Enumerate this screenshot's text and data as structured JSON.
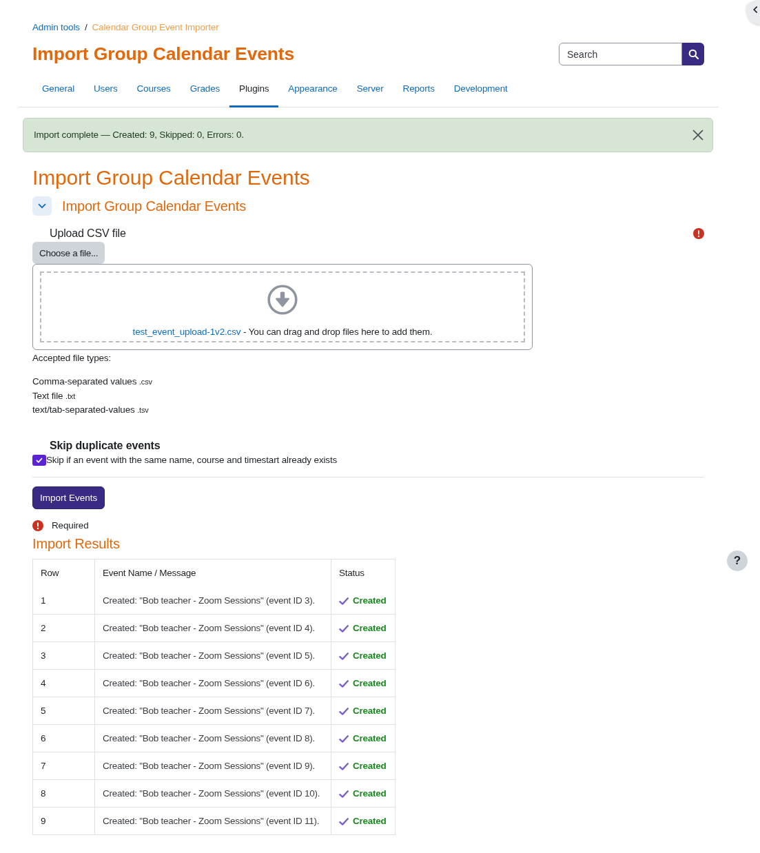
{
  "breadcrumb": {
    "separator": "/",
    "items": [
      {
        "label": "Admin tools",
        "kind": "link"
      },
      {
        "label": "Calendar Group Event Importer",
        "kind": "current"
      }
    ]
  },
  "page_title": "Import Group Calendar Events",
  "search": {
    "placeholder": "Search"
  },
  "tabs": [
    {
      "label": "General",
      "selected": false
    },
    {
      "label": "Users",
      "selected": false
    },
    {
      "label": "Courses",
      "selected": false
    },
    {
      "label": "Grades",
      "selected": false
    },
    {
      "label": "Plugins",
      "selected": true
    },
    {
      "label": "Appearance",
      "selected": false
    },
    {
      "label": "Server",
      "selected": false
    },
    {
      "label": "Reports",
      "selected": false
    },
    {
      "label": "Development",
      "selected": false
    }
  ],
  "alert": {
    "message": "Import complete — Created: 9, Skipped: 0, Errors: 0.",
    "dismissible": true
  },
  "heading": "Import Group Calendar Events",
  "section": {
    "title": "Import Group Calendar Events",
    "expanded": true
  },
  "upload": {
    "label": "Upload CSV file",
    "required": true,
    "button": "Choose a file...",
    "file_name": "test_event_upload-1v2.csv",
    "drop_hint": "- You can drag and drop files here to add them.",
    "accepted_label": "Accepted file types:",
    "file_types": [
      {
        "name": "Comma-separated values",
        "extension": ".csv"
      },
      {
        "name": "Text file",
        "extension": ".txt"
      },
      {
        "name": "text/tab-separated-values",
        "extension": ".tsv"
      }
    ]
  },
  "skip_duplicates": {
    "title": "Skip duplicate events",
    "label": "Skip if an event with the same name, course and timestart already exists",
    "checked": true
  },
  "submit_button": "Import Events",
  "required_note": "Required",
  "results": {
    "title": "Import Results",
    "columns": [
      "Row",
      "Event Name / Message",
      "Status"
    ],
    "rows": [
      {
        "row": "1",
        "message": "Created: \"Bob teacher - Zoom Sessions\" (event ID 3).",
        "status": "Created",
        "kind": "created"
      },
      {
        "row": "2",
        "message": "Created: \"Bob teacher - Zoom Sessions\" (event ID 4).",
        "status": "Created",
        "kind": "created"
      },
      {
        "row": "3",
        "message": "Created: \"Bob teacher - Zoom Sessions\" (event ID 5).",
        "status": "Created",
        "kind": "created"
      },
      {
        "row": "4",
        "message": "Created: \"Bob teacher - Zoom Sessions\" (event ID 6).",
        "status": "Created",
        "kind": "created"
      },
      {
        "row": "5",
        "message": "Created: \"Bob teacher - Zoom Sessions\" (event ID 7).",
        "status": "Created",
        "kind": "created"
      },
      {
        "row": "6",
        "message": "Created: \"Bob teacher - Zoom Sessions\" (event ID 8).",
        "status": "Created",
        "kind": "created"
      },
      {
        "row": "7",
        "message": "Created: \"Bob teacher - Zoom Sessions\" (event ID 9).",
        "status": "Created",
        "kind": "created"
      },
      {
        "row": "8",
        "message": "Created: \"Bob teacher - Zoom Sessions\" (event ID 10).",
        "status": "Created",
        "kind": "created"
      },
      {
        "row": "9",
        "message": "Created: \"Bob teacher - Zoom Sessions\" (event ID 11).",
        "status": "Created",
        "kind": "created"
      }
    ]
  },
  "help_button": "?"
}
